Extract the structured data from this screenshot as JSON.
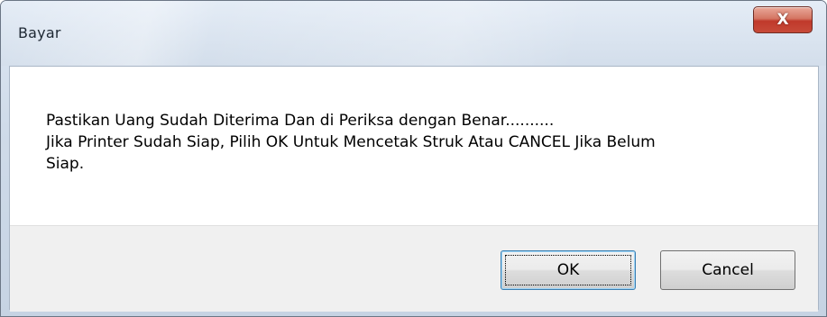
{
  "window": {
    "title": "Bayar"
  },
  "titlebar": {
    "close_icon": "close-icon",
    "close_glyph": "X"
  },
  "message": {
    "lines": [
      "Pastikan Uang Sudah Diterima Dan di Periksa dengan Benar..........",
      "Jika Printer Sudah Siap, Pilih OK Untuk Mencetak Struk Atau CANCEL Jika Belum",
      "Siap."
    ]
  },
  "buttons": {
    "ok_label": "OK",
    "cancel_label": "Cancel"
  },
  "colors": {
    "close_button": "#c74a39",
    "default_button_border": "#3c7fb1",
    "button_area": "#f0f0f0"
  }
}
